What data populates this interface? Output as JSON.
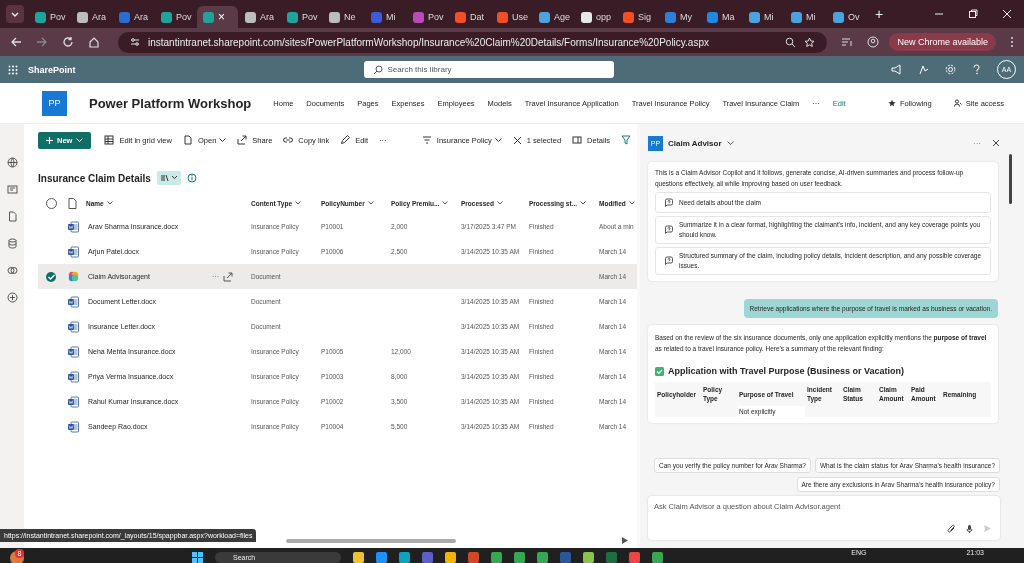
{
  "browser": {
    "tabs": [
      {
        "label": "Pov",
        "color": "#1fa39a",
        "selected": false
      },
      {
        "label": "Ara",
        "color": "#bdbdbd",
        "selected": false
      },
      {
        "label": "Ara",
        "color": "#2b6cd4",
        "selected": false
      },
      {
        "label": "Pov",
        "color": "#1fa39a",
        "selected": false
      },
      {
        "color": "#1fa39a",
        "selected": true
      },
      {
        "label": "Ara",
        "color": "#bdbdbd",
        "selected": false
      },
      {
        "label": "Pov",
        "color": "#1fa39a",
        "selected": false
      },
      {
        "label": "Ne",
        "color": "#bdbdbd",
        "selected": false
      },
      {
        "label": "Mi",
        "color": "#3b5bdb",
        "selected": false
      },
      {
        "label": "Pov",
        "color": "#b84bb8",
        "selected": false
      },
      {
        "label": "Dat",
        "color": "#f25022",
        "selected": false
      },
      {
        "label": "Use",
        "color": "#f25022",
        "selected": false
      },
      {
        "label": "Age",
        "color": "#4aa3df",
        "selected": false
      },
      {
        "label": "opp",
        "color": "#e8e8e8",
        "selected": false
      },
      {
        "label": "Sig",
        "color": "#f25022",
        "selected": false
      },
      {
        "label": "My",
        "color": "#2f7fd8",
        "selected": false
      },
      {
        "label": "Ma",
        "color": "#1e88e5",
        "selected": false
      },
      {
        "label": "Mi",
        "color": "#4aa3df",
        "selected": false
      },
      {
        "label": "Mi",
        "color": "#4aa3df",
        "selected": false
      },
      {
        "label": "Ov",
        "color": "#4aa3df",
        "selected": false
      }
    ],
    "close_tab": "×",
    "new_tab": "+",
    "url": "instantintranet.sharepoint.com/sites/PowerPlatformWorkshop/Insurance%20Claim%20Details/Forms/Insurance%20Policy.aspx",
    "update": "New Chrome available"
  },
  "suite": {
    "app": "SharePoint",
    "search": {
      "placeholder": "Search this library"
    },
    "avatar": "AA"
  },
  "site": {
    "logo": "PP",
    "title": "Power Platform Workshop",
    "nav": [
      "Home",
      "Documents",
      "Pages",
      "Expenses",
      "Employees",
      "Models",
      "Travel Insurance Application",
      "Travel Insurance Policy",
      "Travel Insurance Claim"
    ],
    "more": "···",
    "edit": "Edit",
    "following": "Following",
    "site_access": "Site access"
  },
  "commands": {
    "new": "New",
    "items": [
      {
        "label": "Edit in grid view",
        "kind": "grid"
      },
      {
        "label": "Open",
        "kind": "open"
      },
      {
        "label": "Share",
        "kind": "share"
      },
      {
        "label": "Copy link",
        "kind": "link"
      },
      {
        "label": "Edit",
        "kind": "edit"
      }
    ],
    "more": "···",
    "view": "Insurance Policy",
    "selected_count": "1 selected",
    "details": "Details"
  },
  "library": {
    "title": "Insurance Claim Details",
    "select_all": {
      "checked": false
    },
    "columns": [
      "Name",
      "Content Type",
      "PolicyNumber",
      "Policy Premiu...",
      "Processed",
      "Processing st...",
      "Modified"
    ],
    "rows": [
      {
        "name": "Arav Sharma Insurance.docx",
        "kind": "word",
        "content_type": "Insurance Policy",
        "policy": "P10001",
        "premium": "2,000",
        "processed": "3/17/2025 3:47 PM",
        "status": "Finished",
        "modified": "About a min",
        "selected": false
      },
      {
        "name": "Arjun Patel.docx",
        "kind": "word",
        "content_type": "Insurance Policy",
        "policy": "P10006",
        "premium": "2,500",
        "processed": "3/14/2025 10:35 AM",
        "status": "Finished",
        "modified": "March 14",
        "selected": false
      },
      {
        "name": "Claim Advisor.agent",
        "kind": "agent",
        "more": "···",
        "content_type": "Document",
        "modified": "March 14",
        "selected": true
      },
      {
        "name": "Document Letter.docx",
        "kind": "word",
        "content_type": "Document",
        "processed": "3/14/2025 10:35 AM",
        "status": "Finished",
        "modified": "March 14",
        "selected": false
      },
      {
        "name": "Insurance Letter.docx",
        "kind": "word",
        "content_type": "Document",
        "processed": "3/14/2025 10:35 AM",
        "status": "Finished",
        "modified": "March 14",
        "selected": false
      },
      {
        "name": "Neha Mehta Insurance.docx",
        "kind": "word",
        "content_type": "Insurance Policy",
        "policy": "P10005",
        "premium": "12,000",
        "processed": "3/14/2025 10:35 AM",
        "status": "Finished",
        "modified": "March 14",
        "selected": false
      },
      {
        "name": "Priya Verma Insuance.docx",
        "kind": "word",
        "content_type": "Insurance Policy",
        "policy": "P10003",
        "premium": "8,000",
        "processed": "3/14/2025 10:35 AM",
        "status": "Finished",
        "modified": "March 14",
        "selected": false
      },
      {
        "name": "Rahul Kumar Insurance.docx",
        "kind": "word",
        "content_type": "Insurance Policy",
        "policy": "P10002",
        "premium": "3,500",
        "processed": "3/14/2025 10:35 AM",
        "status": "Finished",
        "modified": "March 14",
        "selected": false
      },
      {
        "name": "Sandeep Rao.docx",
        "kind": "word",
        "content_type": "Insurance Policy",
        "policy": "P10004",
        "premium": "5,500",
        "processed": "3/14/2025 10:35 AM",
        "status": "Finished",
        "modified": "March 14",
        "selected": false
      }
    ]
  },
  "chat": {
    "logo": "PP",
    "title": "Claim Advisor",
    "more": "···",
    "intro": "This is a Claim Advisor Copilot and it follows, generate concise, AI-driven summaries and process follow-up questions effectively, all while improving based on user feedback.",
    "suggestions": [
      "Need details about the claim",
      "Summarize it in a clear format, highlighting the claimant's info, incident, and any key coverage points you should know.",
      "Structured summary of the claim, including policy details, incident description, and any possible coverage issues."
    ],
    "user_message": "Retrieve applications where the purpose of travel is marked as business or vacation.",
    "reply": "Based on the review of the six insurance documents, only one application explicitly mentions the **purpose of travel** as related to a travel insurance policy. Here's a summary of the relevant finding:",
    "heading": "Application with Travel Purpose (Business or Vacation)",
    "table_columns": [
      "Policyholder",
      "Policy Type",
      "Purpose of Travel",
      "Incident Type",
      "Claim Status",
      "Claim Amount",
      "Paid Amount",
      "Remaining"
    ],
    "table_cell": "Not explicitly",
    "chips": [
      "Can you verify the policy number for Arav Sharma?",
      "What is the claim status for Arav Sharma's health insurance?",
      "Are there any exclusions in Arav Sharma's health insurance policy?"
    ],
    "input": {
      "placeholder": "Ask Claim Advisor a question about Claim Advisor.agent"
    }
  },
  "status_url": "https://instantintranet.sharepoint.com/_layouts/15/spappbar.aspx?workload=files",
  "taskbar": {
    "search": "Search",
    "badge": "8",
    "language": "ENG",
    "time": "21:03"
  }
}
